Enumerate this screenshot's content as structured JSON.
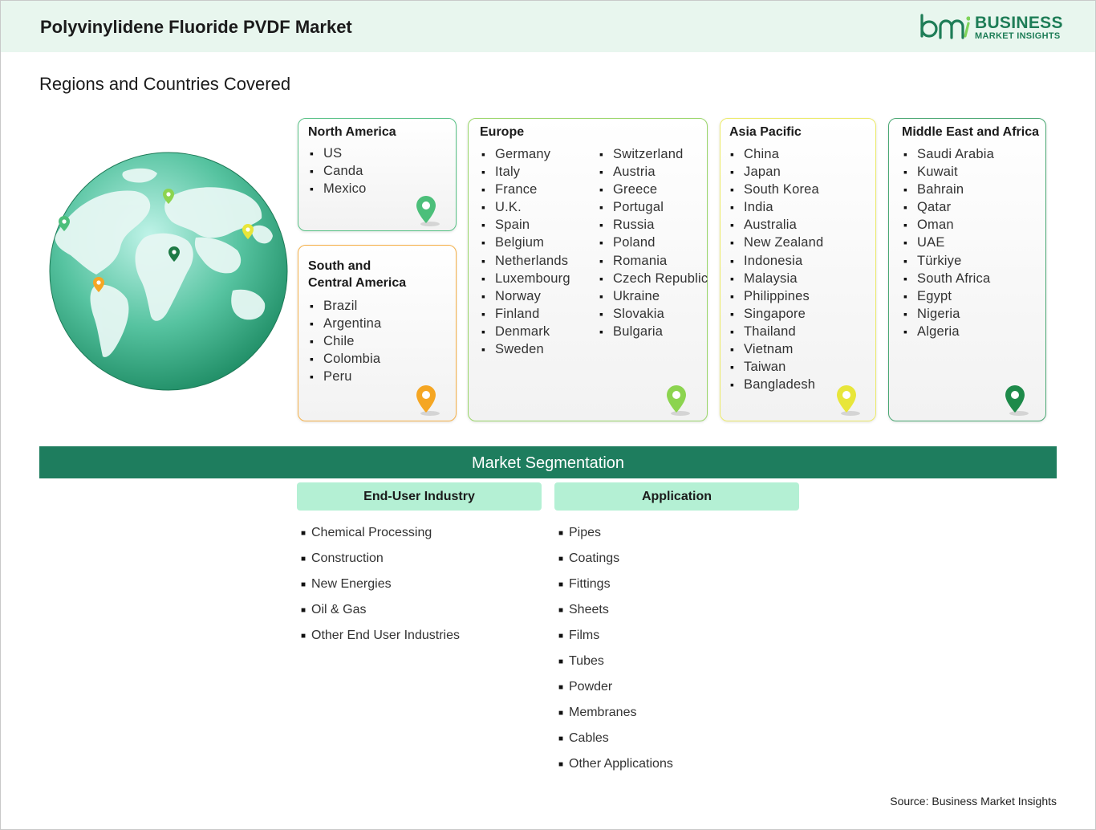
{
  "header": {
    "title": "Polyvinylidene Fluoride PVDF Market",
    "logo": {
      "line1": "BUSINESS",
      "line2": "MARKET INSIGHTS",
      "mark": "bmi",
      "color": "#1e7d57"
    }
  },
  "regions_title": "Regions and Countries Covered",
  "regions": [
    {
      "name": "North America",
      "color": "#4cbf7a",
      "countries": [
        "US",
        "Canda",
        "Mexico"
      ]
    },
    {
      "name_lines": [
        "South and",
        "Central America"
      ],
      "color": "#f5a623",
      "countries": [
        "Brazil",
        "Argentina",
        "Chile",
        "Colombia",
        "Peru"
      ]
    },
    {
      "name": "Europe",
      "color": "#8cd44f",
      "countries_col1": [
        "Germany",
        "Italy",
        "France",
        "U.K.",
        "Spain",
        "Belgium",
        "Netherlands",
        "Luxembourg",
        "Norway",
        "Finland",
        "Denmark",
        "Sweden"
      ],
      "countries_col2": [
        "Switzerland",
        "Austria",
        "Greece",
        "Portugal",
        "Russia",
        "Poland",
        "Romania",
        "Czech Republic",
        "Ukraine",
        "Slovakia",
        "Bulgaria"
      ]
    },
    {
      "name": "Asia Pacific",
      "color": "#e8e63a",
      "countries": [
        "China",
        "Japan",
        "South Korea",
        "India",
        "Australia",
        "New Zealand",
        "Indonesia",
        "Malaysia",
        "Philippines",
        "Singapore",
        "Thailand",
        "Vietnam",
        "Taiwan",
        "Bangladesh"
      ]
    },
    {
      "name": "Middle East and Africa",
      "color": "#1e8a4a",
      "countries": [
        "Saudi Arabia",
        "Kuwait",
        "Bahrain",
        "Qatar",
        "Oman",
        "UAE",
        "Türkiye",
        "South Africa",
        "Egypt",
        "Nigeria",
        "Algeria"
      ]
    }
  ],
  "segmentation": {
    "title": "Market Segmentation",
    "groups": [
      {
        "heading": "End-User Industry",
        "items": [
          "Chemical Processing",
          "Construction",
          "New Energies",
          "Oil & Gas",
          "Other End User Industries"
        ]
      },
      {
        "heading": "Application",
        "items": [
          "Pipes",
          "Coatings",
          "Fittings",
          "Sheets",
          "Films",
          "Tubes",
          "Powder",
          "Membranes",
          "Cables",
          "Other Applications"
        ]
      }
    ]
  },
  "source": "Source: Business Market Insights",
  "icons": [
    "globe-icon",
    "map-pin-icon",
    "bmi-logo-icon"
  ]
}
